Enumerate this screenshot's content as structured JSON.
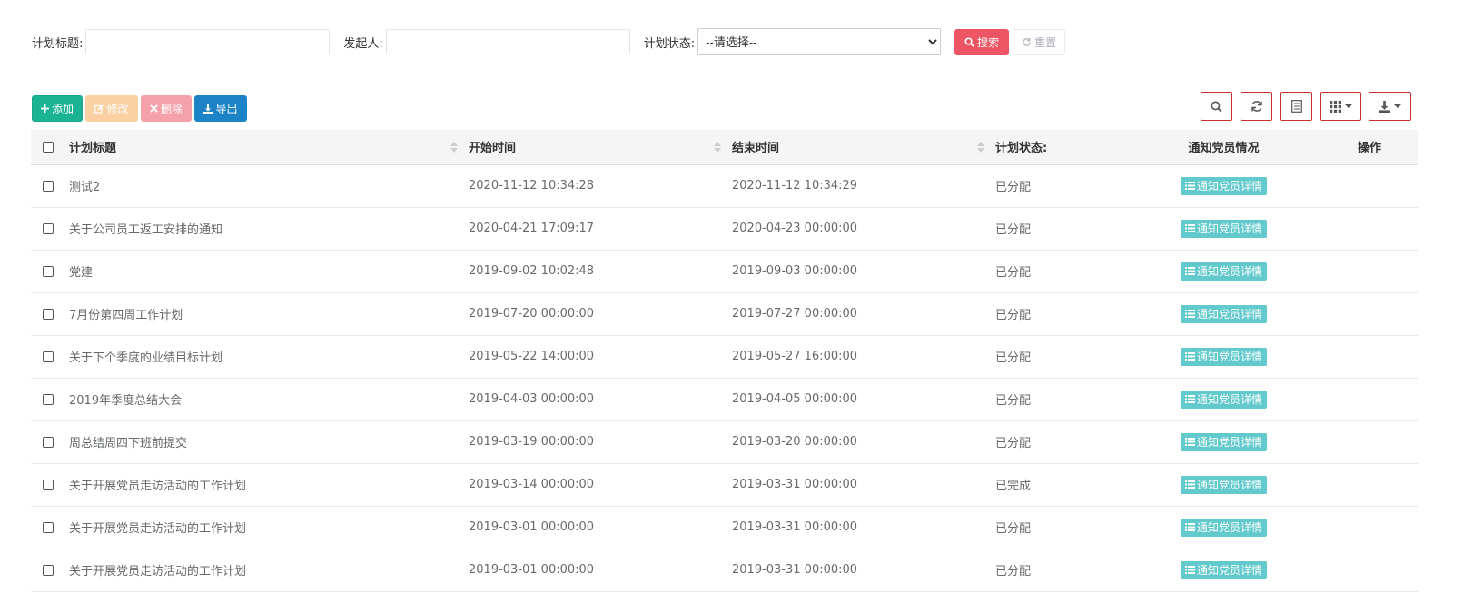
{
  "search": {
    "title_label": "计划标题:",
    "title_value": "",
    "initiator_label": "发起人:",
    "initiator_value": "",
    "status_label": "计划状态:",
    "status_selected": "--请选择--",
    "search_button": "搜索",
    "reset_button": "重置"
  },
  "toolbar": {
    "add": "添加",
    "edit": "修改",
    "delete": "删除",
    "export": "导出"
  },
  "table": {
    "columns": [
      "计划标题",
      "开始时间",
      "结束时间",
      "计划状态:",
      "通知党员情况",
      "操作"
    ],
    "detail_label": "通知党员详情",
    "rows": [
      {
        "title": "测试2",
        "start": "2020-11-12 10:34:28",
        "end": "2020-11-12 10:34:29",
        "status": "已分配"
      },
      {
        "title": "关于公司员工返工安排的通知",
        "start": "2020-04-21 17:09:17",
        "end": "2020-04-23 00:00:00",
        "status": "已分配"
      },
      {
        "title": "党建",
        "start": "2019-09-02 10:02:48",
        "end": "2019-09-03 00:00:00",
        "status": "已分配"
      },
      {
        "title": "7月份第四周工作计划",
        "start": "2019-07-20 00:00:00",
        "end": "2019-07-27 00:00:00",
        "status": "已分配"
      },
      {
        "title": "关于下个季度的业绩目标计划",
        "start": "2019-05-22 14:00:00",
        "end": "2019-05-27 16:00:00",
        "status": "已分配"
      },
      {
        "title": "2019年季度总结大会",
        "start": "2019-04-03 00:00:00",
        "end": "2019-04-05 00:00:00",
        "status": "已分配"
      },
      {
        "title": "周总结周四下班前提交",
        "start": "2019-03-19 00:00:00",
        "end": "2019-03-20 00:00:00",
        "status": "已分配"
      },
      {
        "title": "关于开展党员走访活动的工作计划",
        "start": "2019-03-14 00:00:00",
        "end": "2019-03-31 00:00:00",
        "status": "已完成"
      },
      {
        "title": "关于开展党员走访活动的工作计划",
        "start": "2019-03-01 00:00:00",
        "end": "2019-03-31 00:00:00",
        "status": "已分配"
      },
      {
        "title": "关于开展党员走访活动的工作计划",
        "start": "2019-03-01 00:00:00",
        "end": "2019-03-31 00:00:00",
        "status": "已分配"
      }
    ]
  },
  "colors": {
    "search_button": "#ed5565",
    "add_button": "#1ab394",
    "export_button": "#1c84c6",
    "detail_badge": "#62c9cc"
  }
}
